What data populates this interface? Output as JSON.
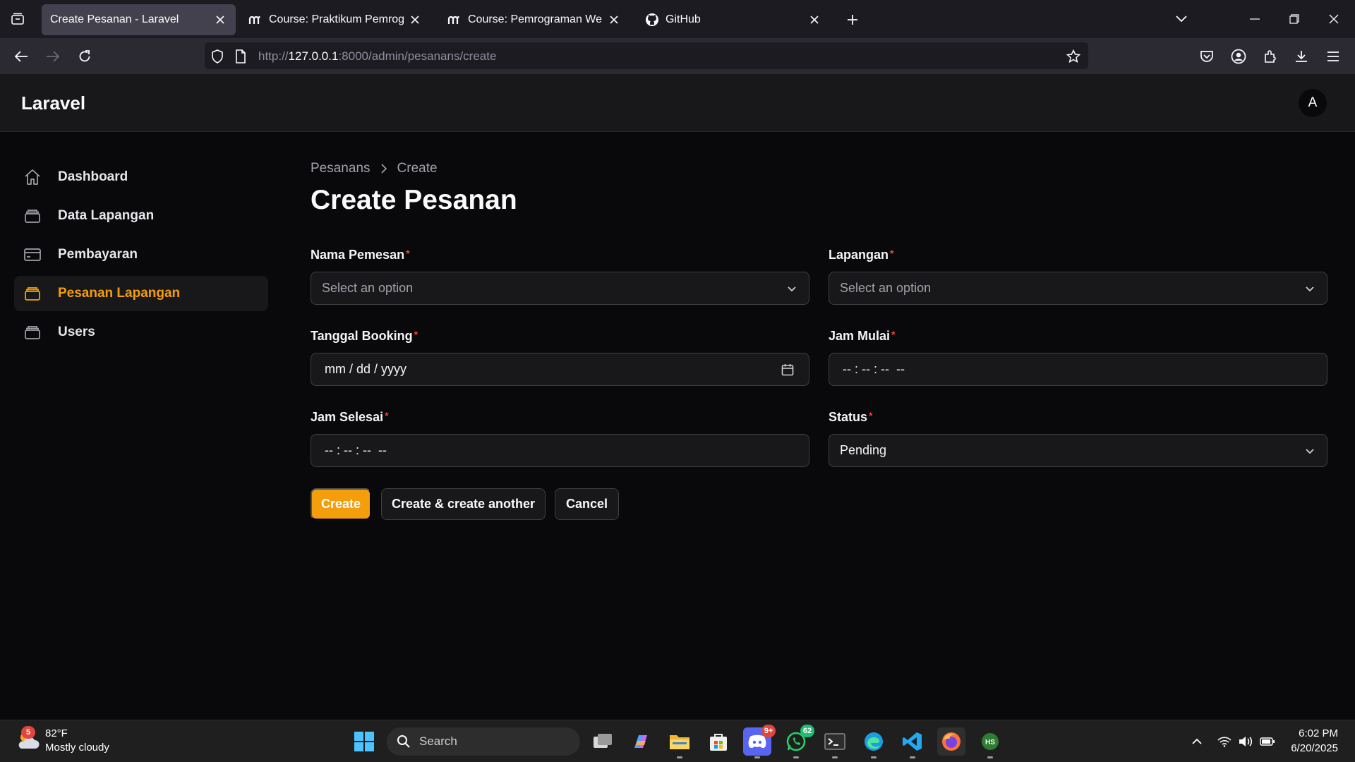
{
  "browser": {
    "tabs": [
      {
        "title": "Create Pesanan - Laravel",
        "active": true
      },
      {
        "title": "Course: Praktikum Pemrograman",
        "active": false
      },
      {
        "title": "Course: Pemrograman Web Framework",
        "active": false
      },
      {
        "title": "GitHub",
        "active": false
      }
    ],
    "url": {
      "prefix": "http://",
      "host": "127.0.0.1",
      "rest": ":8000/admin/pesanans/create"
    }
  },
  "app": {
    "brand": "Laravel",
    "avatar_initial": "A",
    "accent_color": "#f59e0b",
    "sidebar": {
      "items": [
        {
          "label": "Dashboard",
          "icon": "home-icon",
          "active": false
        },
        {
          "label": "Data Lapangan",
          "icon": "stack-icon",
          "active": false
        },
        {
          "label": "Pembayaran",
          "icon": "credit-card-icon",
          "active": false
        },
        {
          "label": "Pesanan Lapangan",
          "icon": "stack-icon",
          "active": true
        },
        {
          "label": "Users",
          "icon": "stack-icon",
          "active": false
        }
      ]
    },
    "breadcrumb": [
      "Pesanans",
      "Create"
    ],
    "page_title": "Create Pesanan",
    "form": {
      "nama_pemesan": {
        "label": "Nama Pemesan",
        "required_mark": "*",
        "placeholder": "Select an option"
      },
      "lapangan": {
        "label": "Lapangan",
        "required_mark": "*",
        "placeholder": "Select an option"
      },
      "tanggal_booking": {
        "label": "Tanggal Booking",
        "required_mark": "*",
        "placeholder": "mm / dd / yyyy"
      },
      "jam_mulai": {
        "label": "Jam Mulai",
        "required_mark": "*",
        "placeholder": "-- : -- : --  --"
      },
      "jam_selesai": {
        "label": "Jam Selesai",
        "required_mark": "*",
        "placeholder": "-- : -- : --  --"
      },
      "status": {
        "label": "Status",
        "required_mark": "*",
        "value": "Pending"
      }
    },
    "actions": {
      "create": "Create",
      "create_another": "Create & create another",
      "cancel": "Cancel"
    }
  },
  "taskbar": {
    "weather": {
      "temp": "82°F",
      "desc": "Mostly cloudy",
      "badge": "5"
    },
    "search_label": "Search",
    "discord_badge": "9+",
    "whatsapp_badge": "62",
    "clock": {
      "time": "6:02 PM",
      "date": "6/20/2025"
    }
  }
}
